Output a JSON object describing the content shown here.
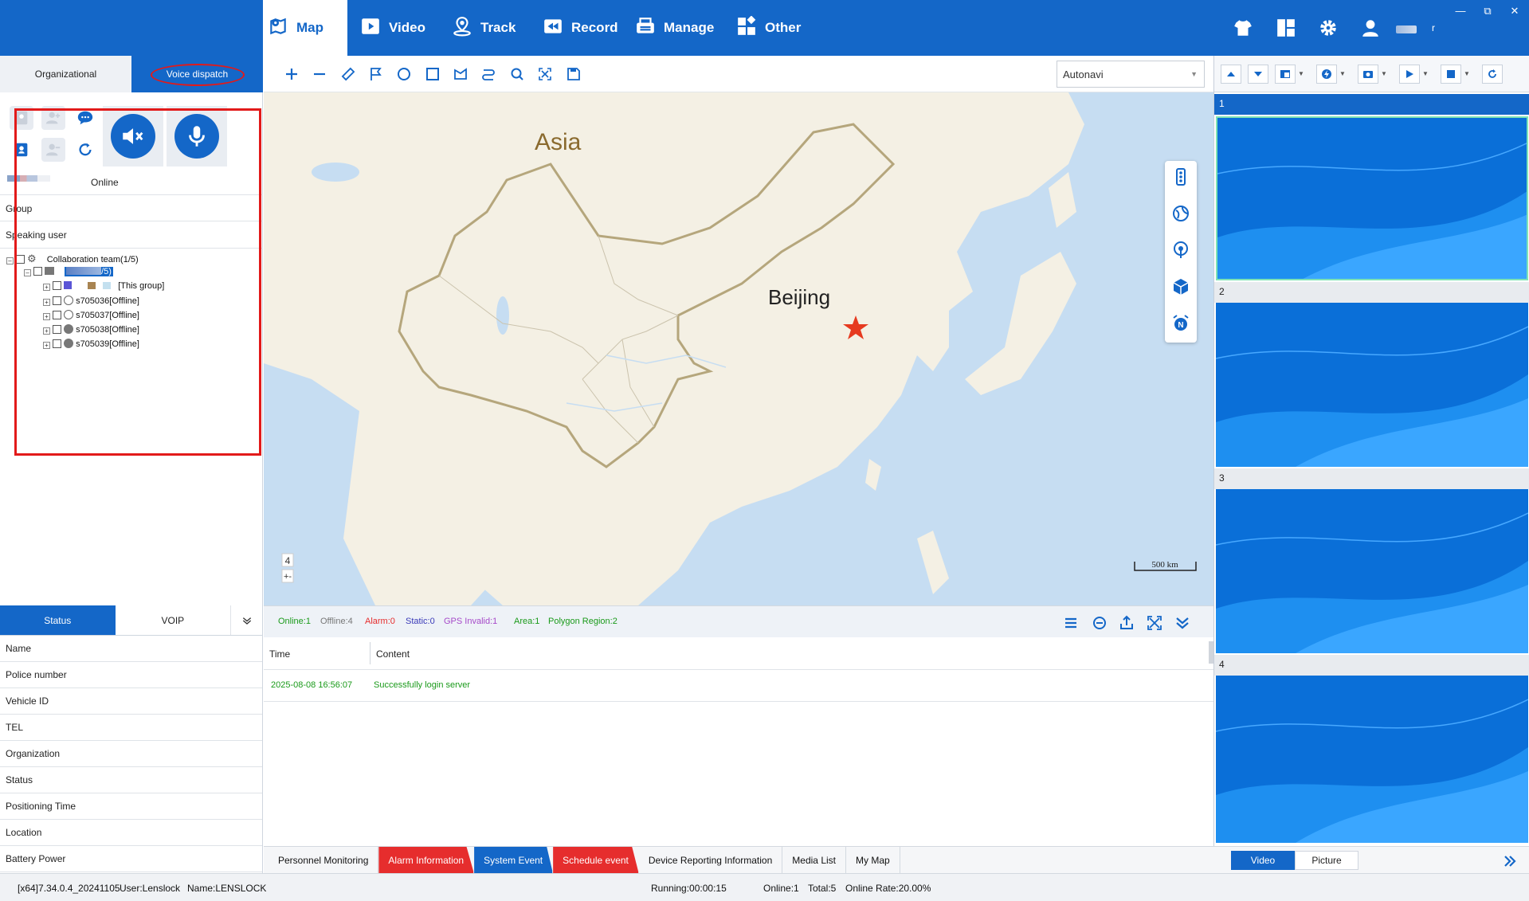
{
  "nav": {
    "tabs": [
      {
        "label": "Map",
        "icon": "map-pin-icon",
        "active": true
      },
      {
        "label": "Video",
        "icon": "video-play-icon"
      },
      {
        "label": "Track",
        "icon": "track-pin-icon"
      },
      {
        "label": "Record",
        "icon": "record-rewind-icon"
      },
      {
        "label": "Manage",
        "icon": "manage-printer-icon"
      },
      {
        "label": "Other",
        "icon": "grid-icon"
      }
    ],
    "user_initial": "r"
  },
  "left_panel": {
    "tabs": {
      "organizational": "Organizational",
      "voice_dispatch": "Voice dispatch"
    },
    "online_label": "Online",
    "group_label": "Group",
    "speaking_user_label": "Speaking user",
    "tree": {
      "root": "Collaboration team(1/5)",
      "sub_group_count": "/5)",
      "this_group": "[This group]",
      "devices": [
        "s705036[Offline]",
        "s705037[Offline]",
        "s705038[Offline]",
        "s705039[Offline]"
      ]
    }
  },
  "status_panel": {
    "tabs": {
      "status": "Status",
      "voip": "VOIP"
    },
    "rows": [
      "Name",
      "Police number",
      "Vehicle ID",
      "TEL",
      "Organization",
      "Status",
      "Positioning Time",
      "Location",
      "Battery Power"
    ]
  },
  "map": {
    "provider": "Autonavi",
    "labels": {
      "continent": "Asia",
      "city": "Beijing"
    },
    "scale": "500 km",
    "zoom": "4",
    "zoom_toggle": "+-"
  },
  "events": {
    "stats": {
      "online": "Online:1",
      "offline": "Offline:4",
      "alarm": "Alarm:0",
      "static": "Static:0",
      "gps_invalid": "GPS Invalid:1",
      "area": "Area:1",
      "polygon": "Polygon Region:2"
    },
    "columns": {
      "time": "Time",
      "content": "Content"
    },
    "rows": [
      {
        "time": "2025-08-08 16:56:07",
        "content": "Successfully login server"
      }
    ],
    "tabs": [
      "Personnel Monitoring",
      "Alarm Information",
      "System Event",
      "Schedule event",
      "Device Reporting Information",
      "Media List",
      "My Map"
    ]
  },
  "video_panel": {
    "channels": [
      "1",
      "2",
      "3",
      "4"
    ],
    "tabs": {
      "video": "Video",
      "picture": "Picture"
    }
  },
  "statusbar": {
    "version": "[x64]7.34.0.4_20241105",
    "user": "User:Lenslock",
    "name": "Name:LENSLOCK",
    "running": "Running:00:00:15",
    "online": "Online:1",
    "total": "Total:5",
    "online_rate": "Online Rate:20.00%"
  },
  "colors": {
    "primary": "#1467c8",
    "alarm_red": "#e62d2d",
    "online_green": "#1a9a1a",
    "map_land": "#f4f0e4",
    "map_water": "#c6ddf2"
  }
}
